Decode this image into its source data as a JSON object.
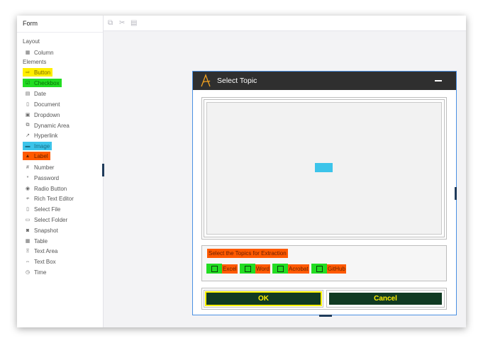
{
  "sidebar": {
    "title": "Form",
    "layout_label": "Layout",
    "layout_items": [
      {
        "label": "Column",
        "icon": "column-icon"
      }
    ],
    "elements_label": "Elements",
    "elements": [
      {
        "label": "Button",
        "icon": "button-icon",
        "highlight": "yellow"
      },
      {
        "label": "Checkbox",
        "icon": "checkbox-icon",
        "highlight": "green"
      },
      {
        "label": "Date",
        "icon": "calendar-icon"
      },
      {
        "label": "Document",
        "icon": "document-icon"
      },
      {
        "label": "Dropdown",
        "icon": "dropdown-icon"
      },
      {
        "label": "Dynamic Area",
        "icon": "dynamic-area-icon"
      },
      {
        "label": "Hyperlink",
        "icon": "hyperlink-icon"
      },
      {
        "label": "Image",
        "icon": "image-icon",
        "highlight": "blue"
      },
      {
        "label": "Label",
        "icon": "label-icon",
        "highlight": "orange"
      },
      {
        "label": "Number",
        "icon": "hash-icon"
      },
      {
        "label": "Password",
        "icon": "password-icon"
      },
      {
        "label": "Radio Button",
        "icon": "radio-icon"
      },
      {
        "label": "Rich Text Editor",
        "icon": "rich-text-icon"
      },
      {
        "label": "Select File",
        "icon": "file-icon"
      },
      {
        "label": "Select Folder",
        "icon": "folder-icon"
      },
      {
        "label": "Snapshot",
        "icon": "camera-icon"
      },
      {
        "label": "Table",
        "icon": "table-icon"
      },
      {
        "label": "Text Area",
        "icon": "text-area-icon"
      },
      {
        "label": "Text Box",
        "icon": "text-box-icon"
      },
      {
        "label": "Time",
        "icon": "clock-icon"
      }
    ]
  },
  "toolbar": {
    "icons": [
      "copy-icon",
      "cut-icon",
      "paste-icon"
    ]
  },
  "dialog": {
    "title": "Select Topic",
    "topics_label": "Select the Topics for Extraction",
    "checkboxes": [
      {
        "label": "Excel",
        "checked": false
      },
      {
        "label": "Word",
        "checked": false
      },
      {
        "label": "Acrobat",
        "checked": false
      },
      {
        "label": "GitHub",
        "checked": false
      }
    ],
    "ok_label": "OK",
    "cancel_label": "Cancel"
  },
  "colors": {
    "highlight_yellow": "#ffef00",
    "highlight_green": "#22dd22",
    "highlight_blue": "#3cc4ea",
    "highlight_orange": "#ff5a00",
    "dialog_header": "#2f2f2f",
    "button_bg": "#103a22"
  }
}
